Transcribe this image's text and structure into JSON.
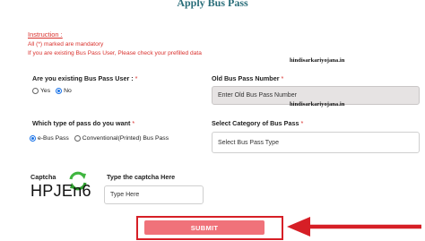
{
  "page": {
    "title": "Apply Bus Pass"
  },
  "instruction": {
    "title": "Instruction :",
    "lines": [
      "All (*) marked are mandatory",
      "If you are existing Bus Pass User, Please check your prefilled data"
    ]
  },
  "existing_user": {
    "label": "Are you existing Bus Pass User :",
    "required_mark": "*",
    "options": [
      "Yes",
      "No"
    ],
    "selected": "No"
  },
  "old_pass": {
    "label": "Old Bus Pass Number",
    "required_mark": "*",
    "placeholder": "Enter Old Bus Pass Number"
  },
  "pass_type": {
    "label": "Which type of pass do you want",
    "required_mark": "*",
    "options": [
      "e-Bus Pass",
      "Conventional(Printed) Bus Pass"
    ],
    "selected": "e-Bus Pass"
  },
  "category": {
    "label": "Select Category of Bus Pass",
    "required_mark": "*",
    "value": "Select Bus Pass Type"
  },
  "captcha": {
    "label": "Captcha",
    "code": "HPJEn6",
    "input_label": "Type the captcha Here",
    "placeholder": "Type Here"
  },
  "watermarks": [
    "hindisarkariyojana.in",
    "hindisarkariyojana.in"
  ],
  "submit": {
    "label": "SUBMIT"
  },
  "colors": {
    "required": "#d9302c",
    "title": "#2a6e7a",
    "submit": "#f0727a",
    "highlight": "#d61f26"
  }
}
